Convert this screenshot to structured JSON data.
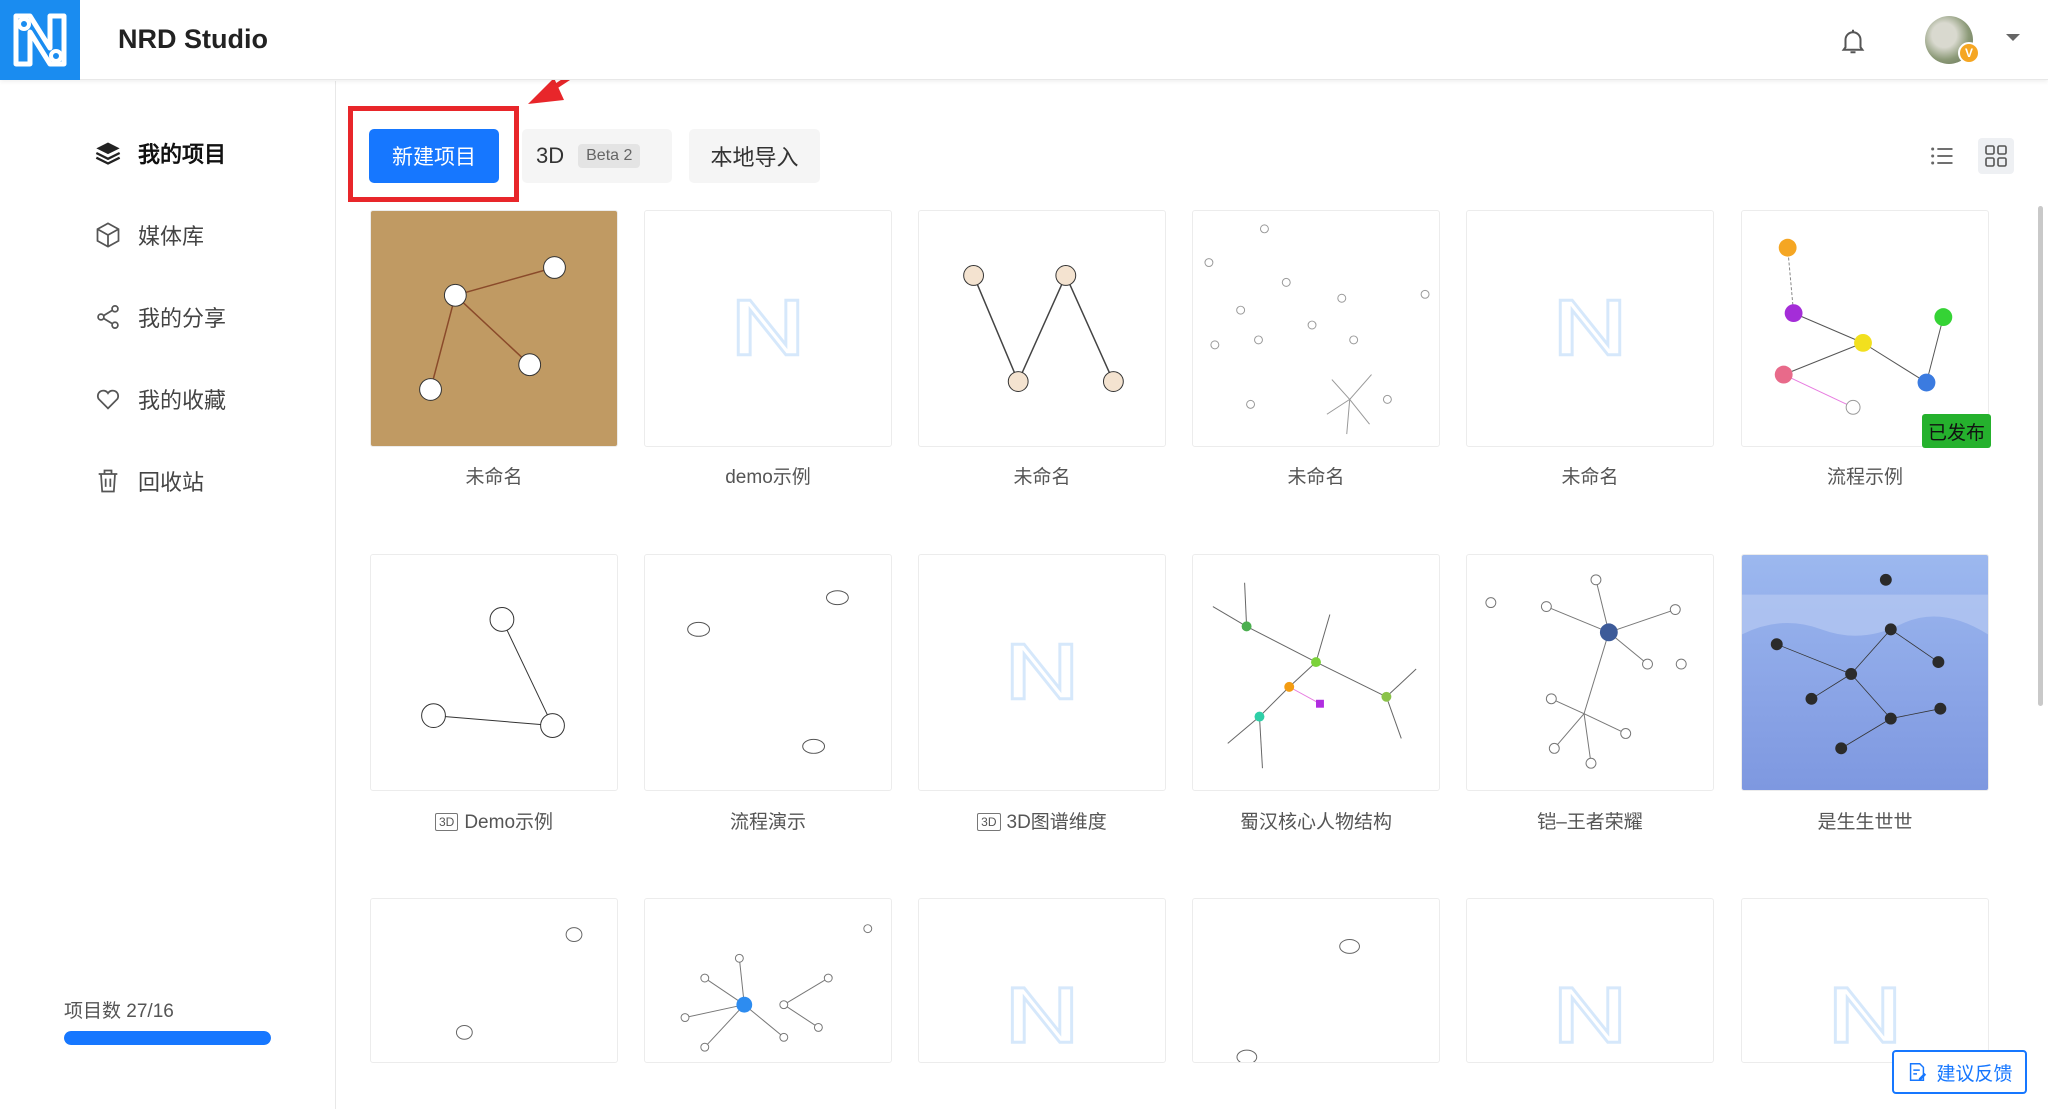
{
  "app": {
    "title": "NRD Studio"
  },
  "header": {
    "avatar_badge": "V"
  },
  "sidebar": {
    "items": [
      {
        "label": "我的项目",
        "icon": "layers-icon"
      },
      {
        "label": "媒体库",
        "icon": "cube-icon"
      },
      {
        "label": "我的分享",
        "icon": "share-icon"
      },
      {
        "label": "我的收藏",
        "icon": "heart-icon"
      },
      {
        "label": "回收站",
        "icon": "trash-icon"
      }
    ],
    "quota": {
      "label": "项目数 27/16",
      "fill": 1.0
    }
  },
  "toolbar": {
    "new_label": "新建项目",
    "three_d_label": "3D",
    "beta_label": "Beta 2",
    "import_label": "本地导入"
  },
  "projects": [
    {
      "name": "未命名"
    },
    {
      "name": "demo示例"
    },
    {
      "name": "未命名"
    },
    {
      "name": "未命名"
    },
    {
      "name": "未命名"
    },
    {
      "name": "流程示例",
      "status": "已发布"
    },
    {
      "name": "Demo示例",
      "tag": "3D"
    },
    {
      "name": "流程演示"
    },
    {
      "name": "3D图谱维度",
      "tag": "3D"
    },
    {
      "name": "蜀汉核心人物结构"
    },
    {
      "name": "铠–王者荣耀"
    },
    {
      "name": "是生生世世"
    }
  ],
  "feedback": {
    "label": "建议反馈"
  },
  "colors": {
    "accent": "#1677ff",
    "logo_bg": "#1a8cf0",
    "highlight": "#e8262a",
    "published": "#25b12d"
  }
}
